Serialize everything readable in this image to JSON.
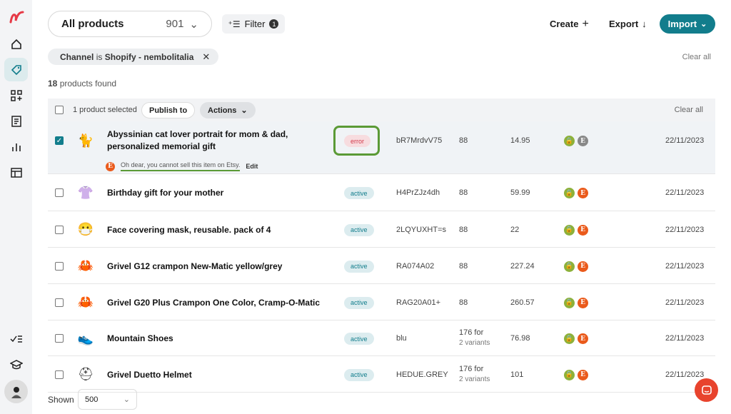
{
  "header": {
    "view_title": "All products",
    "view_count": "901",
    "filter_label": "Filter",
    "filter_count": "1",
    "create_label": "Create",
    "export_label": "Export",
    "import_label": "Import"
  },
  "filter_chip": {
    "field": "Channel",
    "op": "is",
    "value": "Shopify - nembolitalia"
  },
  "clear_all": "Clear all",
  "results": {
    "count": "18",
    "label": "products found"
  },
  "bulk": {
    "selected_text": "1 product selected",
    "publish_label": "Publish to",
    "actions_label": "Actions",
    "clear_all": "Clear all"
  },
  "rows": [
    {
      "name": "Abyssinian cat lover portrait for mom & dad, personalized memorial gift",
      "status": "error",
      "sku": "bR7MrdvV75",
      "qty": "88",
      "qty_sub": "",
      "price": "14.95",
      "date": "22/11/2023",
      "checked": true,
      "etsy_state": "inactive",
      "error": "Oh dear, you cannot sell this item on Etsy.",
      "error_action": "Edit",
      "thumb": "🐈"
    },
    {
      "name": "Birthday gift for your mother",
      "status": "active",
      "sku": "H4PrZJz4dh",
      "qty": "88",
      "qty_sub": "",
      "price": "59.99",
      "date": "22/11/2023",
      "checked": false,
      "thumb": "👚"
    },
    {
      "name": "Face covering mask, reusable. pack of 4",
      "status": "active",
      "sku": "2LQYUXHT=s",
      "qty": "88",
      "qty_sub": "",
      "price": "22",
      "date": "22/11/2023",
      "checked": false,
      "thumb": "😷"
    },
    {
      "name": "Grivel G12 crampon New-Matic yellow/grey",
      "status": "active",
      "sku": "RA074A02",
      "qty": "88",
      "qty_sub": "",
      "price": "227.24",
      "date": "22/11/2023",
      "checked": false,
      "thumb": "🦀"
    },
    {
      "name": "Grivel G20 Plus Crampon One Color, Cramp-O-Matic",
      "status": "active",
      "sku": "RAG20A01+",
      "qty": "88",
      "qty_sub": "",
      "price": "260.57",
      "date": "22/11/2023",
      "checked": false,
      "thumb": "🦀"
    },
    {
      "name": "Mountain Shoes",
      "status": "active",
      "sku": "blu",
      "qty": "176 for",
      "qty_sub": "2 variants",
      "price": "76.98",
      "date": "22/11/2023",
      "checked": false,
      "thumb": "👟"
    },
    {
      "name": "Grivel Duetto Helmet",
      "status": "active",
      "sku": "HEDUE.GREY",
      "qty": "176 for",
      "qty_sub": "2 variants",
      "price": "101",
      "date": "22/11/2023",
      "checked": false,
      "thumb": "⛑"
    }
  ],
  "footer": {
    "shown_label": "Shown",
    "shown_value": "500"
  },
  "colors": {
    "accent": "#127d8c",
    "error": "#d33c4d",
    "shopify": "#8db13a",
    "etsy": "#ea5a1b",
    "highlight": "#5b9a36"
  }
}
